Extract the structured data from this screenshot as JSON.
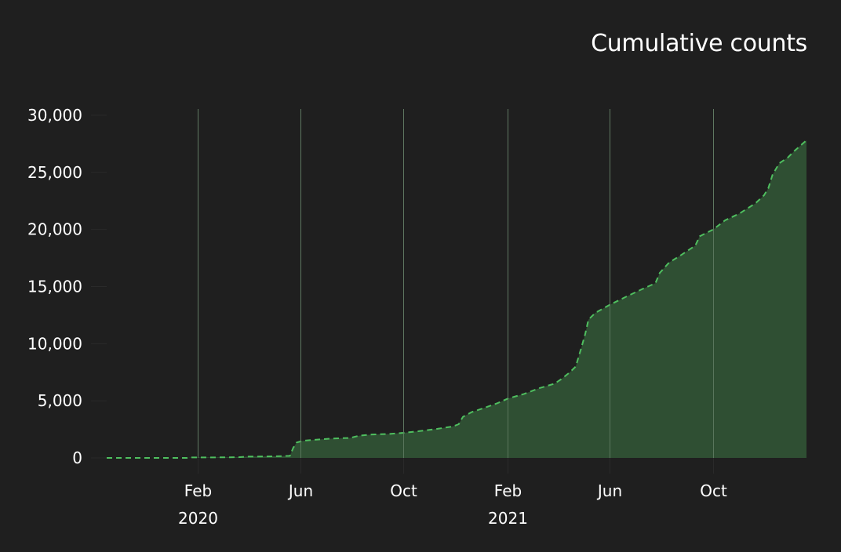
{
  "chart_data": {
    "type": "area",
    "title": "Cumulative counts",
    "xlabel": "",
    "ylabel": "",
    "ylim": [
      0,
      30000
    ],
    "xlim": [
      "2019-10-17",
      "2022-01-19"
    ],
    "grid": {
      "x": true,
      "y": false
    },
    "legend": "none",
    "y_ticks": [
      {
        "value": 0,
        "label": "0"
      },
      {
        "value": 5000,
        "label": "5,000"
      },
      {
        "value": 10000,
        "label": "10,000"
      },
      {
        "value": 15000,
        "label": "15,000"
      },
      {
        "value": 20000,
        "label": "20,000"
      },
      {
        "value": 25000,
        "label": "25,000"
      },
      {
        "value": 30000,
        "label": "30,000"
      }
    ],
    "x_ticks": [
      {
        "date": "2020-02-01",
        "label": "Feb",
        "year_label": "2020"
      },
      {
        "date": "2020-06-01",
        "label": "Jun",
        "year_label": ""
      },
      {
        "date": "2020-10-01",
        "label": "Oct",
        "year_label": ""
      },
      {
        "date": "2021-02-01",
        "label": "Feb",
        "year_label": "2021"
      },
      {
        "date": "2021-06-01",
        "label": "Jun",
        "year_label": ""
      },
      {
        "date": "2021-10-01",
        "label": "Oct",
        "year_label": ""
      }
    ],
    "series": [
      {
        "name": "Cumulative counts",
        "line_color": "#4fbf5f",
        "fill_color": "#2f4f33",
        "line_style": "dashed",
        "points": [
          [
            "2019-10-17",
            0
          ],
          [
            "2020-01-20",
            0
          ],
          [
            "2020-01-25",
            40
          ],
          [
            "2020-03-01",
            50
          ],
          [
            "2020-03-20",
            60
          ],
          [
            "2020-04-01",
            120
          ],
          [
            "2020-04-30",
            140
          ],
          [
            "2020-05-20",
            180
          ],
          [
            "2020-05-24",
            900
          ],
          [
            "2020-05-28",
            1350
          ],
          [
            "2020-06-05",
            1500
          ],
          [
            "2020-06-20",
            1600
          ],
          [
            "2020-07-10",
            1700
          ],
          [
            "2020-07-30",
            1750
          ],
          [
            "2020-08-10",
            1950
          ],
          [
            "2020-08-25",
            2050
          ],
          [
            "2020-09-15",
            2100
          ],
          [
            "2020-10-01",
            2200
          ],
          [
            "2020-10-20",
            2350
          ],
          [
            "2020-11-10",
            2550
          ],
          [
            "2020-11-28",
            2750
          ],
          [
            "2020-12-05",
            2950
          ],
          [
            "2020-12-10",
            3600
          ],
          [
            "2020-12-20",
            4000
          ],
          [
            "2021-01-05",
            4400
          ],
          [
            "2021-01-20",
            4800
          ],
          [
            "2021-02-01",
            5200
          ],
          [
            "2021-02-20",
            5600
          ],
          [
            "2021-03-10",
            6100
          ],
          [
            "2021-03-28",
            6500
          ],
          [
            "2021-04-05",
            6900
          ],
          [
            "2021-04-15",
            7500
          ],
          [
            "2021-04-22",
            8000
          ],
          [
            "2021-04-28",
            9500
          ],
          [
            "2021-05-03",
            10800
          ],
          [
            "2021-05-07",
            12100
          ],
          [
            "2021-05-15",
            12700
          ],
          [
            "2021-06-01",
            13400
          ],
          [
            "2021-06-20",
            14100
          ],
          [
            "2021-07-10",
            14800
          ],
          [
            "2021-07-25",
            15300
          ],
          [
            "2021-07-30",
            16200
          ],
          [
            "2021-08-10",
            17100
          ],
          [
            "2021-08-25",
            17800
          ],
          [
            "2021-09-10",
            18600
          ],
          [
            "2021-09-15",
            19400
          ],
          [
            "2021-10-01",
            20000
          ],
          [
            "2021-10-15",
            20800
          ],
          [
            "2021-11-01",
            21400
          ],
          [
            "2021-11-20",
            22300
          ],
          [
            "2021-11-30",
            23000
          ],
          [
            "2021-12-05",
            23600
          ],
          [
            "2021-12-10",
            24800
          ],
          [
            "2021-12-18",
            25800
          ],
          [
            "2021-12-28",
            26300
          ],
          [
            "2022-01-05",
            26900
          ],
          [
            "2022-01-19",
            27800
          ]
        ]
      }
    ]
  }
}
